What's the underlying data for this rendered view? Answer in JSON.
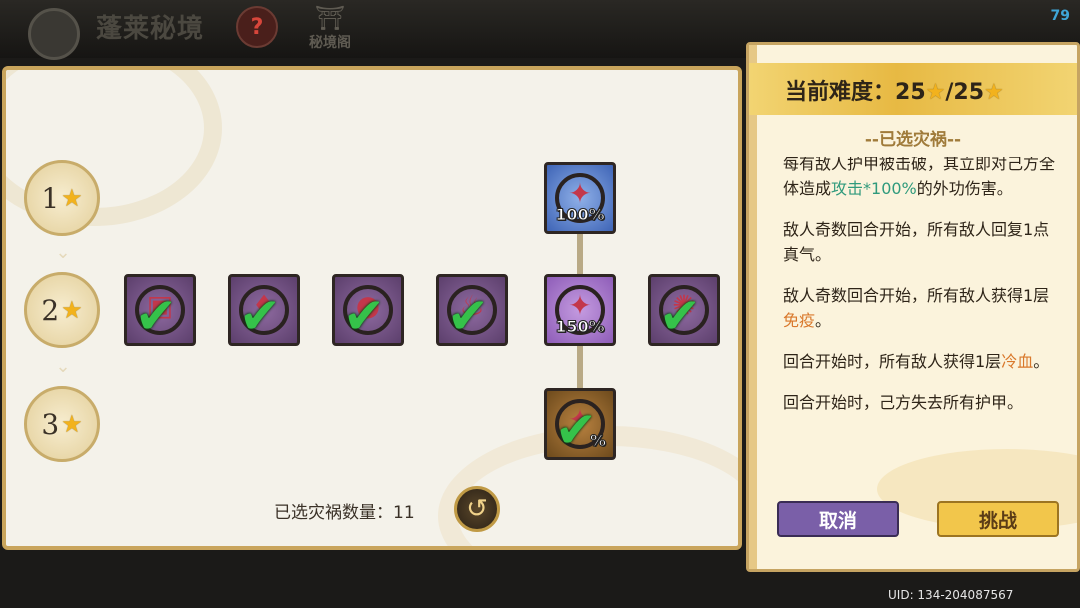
{
  "topbar": {
    "title": "蓬莱秘境",
    "help_icon": "?",
    "pavilion_label": "秘境阁",
    "fps": "79"
  },
  "levels": [
    {
      "label": "1",
      "star": "★"
    },
    {
      "label": "2",
      "star": "★"
    },
    {
      "label": "3",
      "star": "★"
    }
  ],
  "nodes": {
    "top_pct": "100%",
    "mid_pct": "150%",
    "bottom_pct": "%"
  },
  "selected_count": {
    "label": "已选灾祸数量：",
    "value": "11"
  },
  "side": {
    "difficulty_label": "当前难度：",
    "difficulty_current": "25",
    "difficulty_max": "/25",
    "subtitle": "--已选灾祸--",
    "items": [
      {
        "pre": "每有敌人护甲被击破，其立即对己方全体造成",
        "kw": "攻击*100%",
        "post": "的外功伤害。"
      },
      {
        "pre": "敌人奇数回合开始，所有敌人回复1点真气。",
        "kw": "",
        "post": ""
      },
      {
        "pre": "敌人奇数回合开始，所有敌人获得1层",
        "kw": "免疫",
        "post": "。"
      },
      {
        "pre": "回合开始时，所有敌人获得1层",
        "kw": "冷血",
        "post": "。"
      },
      {
        "pre": "回合开始时，己方失去所有护甲。",
        "kw": "",
        "post": ""
      }
    ],
    "cancel_label": "取消",
    "challenge_label": "挑战"
  },
  "uid": "UID: 134-204087567",
  "colors": {
    "accent_gold": "#e7b943",
    "check_green": "#35c24a",
    "cancel_purple": "#7a5fa8"
  }
}
